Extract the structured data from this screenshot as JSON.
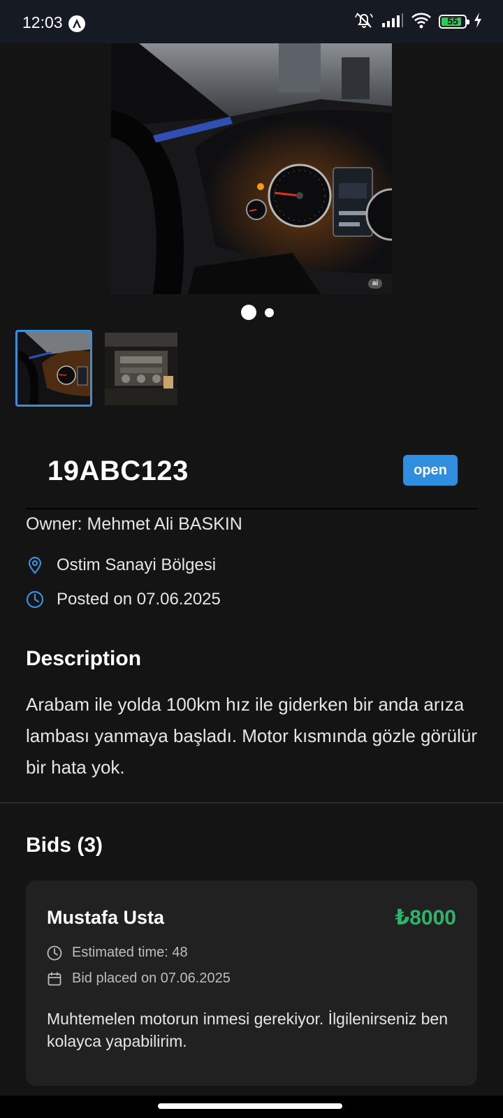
{
  "status_bar": {
    "time": "12:03",
    "battery_level": "55",
    "icons": [
      "notification-a-icon",
      "mute-icon",
      "signal-icon",
      "wifi-icon",
      "battery-icon",
      "charging-icon"
    ]
  },
  "gallery": {
    "image_count": 2,
    "active_index": 0,
    "thumbnails": [
      "dashboard-photo",
      "engine-photo"
    ],
    "hero_badge": "ai"
  },
  "request": {
    "plate": "19ABC123",
    "status": "open",
    "owner": "Owner: Mehmet Ali BASKIN",
    "location": "Ostim Sanayi Bölgesi",
    "posted": "Posted on 07.06.2025"
  },
  "description": {
    "title": "Description",
    "text": "Arabam ile yolda 100km hız ile giderken bir anda arıza lambası yanmaya başladı. Motor kısmında gözle görülür bir hata yok."
  },
  "bids": {
    "title": "Bids (3)",
    "items": [
      {
        "name": "Mustafa Usta",
        "price": "₺8000",
        "estimated_time": "Estimated time: 48",
        "placed": "Bid placed on 07.06.2025",
        "comment": "Muhtemelen motorun inmesi gerekiyor. İlgilenirseniz ben kolayca yapabilirim."
      }
    ]
  },
  "colors": {
    "background": "#141414",
    "accent": "#2f8ede",
    "price": "#2fb36a",
    "card": "#212121"
  }
}
